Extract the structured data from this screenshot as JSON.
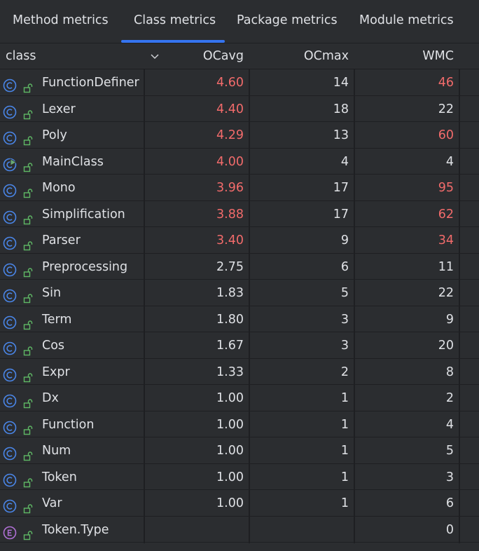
{
  "tabs": [
    {
      "label": "Method metrics",
      "active": false
    },
    {
      "label": "Class metrics",
      "active": true
    },
    {
      "label": "Package metrics",
      "active": false
    },
    {
      "label": "Module metrics",
      "active": false
    }
  ],
  "columns": {
    "class": "class",
    "ocavg": "OCavg",
    "ocmax": "OCmax",
    "wmc": "WMC"
  },
  "colors": {
    "accent": "#3574f0",
    "warning": "#f26b6b",
    "class_icon": "#4a86e8",
    "main_icon": "#6aab73",
    "enum_icon": "#b070d6",
    "lock": "#5fb865"
  },
  "rows": [
    {
      "icon": "class-icon",
      "name": "FunctionDefiner",
      "ocavg": "4.60",
      "ocmax": "14",
      "wmc": "46",
      "ocavg_red": true,
      "wmc_red": true
    },
    {
      "icon": "class-icon",
      "name": "Lexer",
      "ocavg": "4.40",
      "ocmax": "18",
      "wmc": "22",
      "ocavg_red": true,
      "wmc_red": false
    },
    {
      "icon": "class-icon",
      "name": "Poly",
      "ocavg": "4.29",
      "ocmax": "13",
      "wmc": "60",
      "ocavg_red": true,
      "wmc_red": true
    },
    {
      "icon": "main-class-icon",
      "name": "MainClass",
      "ocavg": "4.00",
      "ocmax": "4",
      "wmc": "4",
      "ocavg_red": true,
      "wmc_red": false
    },
    {
      "icon": "class-icon",
      "name": "Mono",
      "ocavg": "3.96",
      "ocmax": "17",
      "wmc": "95",
      "ocavg_red": true,
      "wmc_red": true
    },
    {
      "icon": "class-icon",
      "name": "Simplification",
      "ocavg": "3.88",
      "ocmax": "17",
      "wmc": "62",
      "ocavg_red": true,
      "wmc_red": true
    },
    {
      "icon": "class-icon",
      "name": "Parser",
      "ocavg": "3.40",
      "ocmax": "9",
      "wmc": "34",
      "ocavg_red": true,
      "wmc_red": true
    },
    {
      "icon": "class-icon",
      "name": "Preprocessing",
      "ocavg": "2.75",
      "ocmax": "6",
      "wmc": "11",
      "ocavg_red": false,
      "wmc_red": false
    },
    {
      "icon": "class-icon",
      "name": "Sin",
      "ocavg": "1.83",
      "ocmax": "5",
      "wmc": "22",
      "ocavg_red": false,
      "wmc_red": false
    },
    {
      "icon": "class-icon",
      "name": "Term",
      "ocavg": "1.80",
      "ocmax": "3",
      "wmc": "9",
      "ocavg_red": false,
      "wmc_red": false
    },
    {
      "icon": "class-icon",
      "name": "Cos",
      "ocavg": "1.67",
      "ocmax": "3",
      "wmc": "20",
      "ocavg_red": false,
      "wmc_red": false
    },
    {
      "icon": "class-icon",
      "name": "Expr",
      "ocavg": "1.33",
      "ocmax": "2",
      "wmc": "8",
      "ocavg_red": false,
      "wmc_red": false
    },
    {
      "icon": "class-icon",
      "name": "Dx",
      "ocavg": "1.00",
      "ocmax": "1",
      "wmc": "2",
      "ocavg_red": false,
      "wmc_red": false
    },
    {
      "icon": "class-icon",
      "name": "Function",
      "ocavg": "1.00",
      "ocmax": "1",
      "wmc": "4",
      "ocavg_red": false,
      "wmc_red": false
    },
    {
      "icon": "class-icon",
      "name": "Num",
      "ocavg": "1.00",
      "ocmax": "1",
      "wmc": "5",
      "ocavg_red": false,
      "wmc_red": false
    },
    {
      "icon": "class-icon",
      "name": "Token",
      "ocavg": "1.00",
      "ocmax": "1",
      "wmc": "3",
      "ocavg_red": false,
      "wmc_red": false
    },
    {
      "icon": "class-icon",
      "name": "Var",
      "ocavg": "1.00",
      "ocmax": "1",
      "wmc": "6",
      "ocavg_red": false,
      "wmc_red": false
    },
    {
      "icon": "enum-icon",
      "name": "Token.Type",
      "ocavg": "",
      "ocmax": "",
      "wmc": "0",
      "ocavg_red": false,
      "wmc_red": false
    }
  ]
}
